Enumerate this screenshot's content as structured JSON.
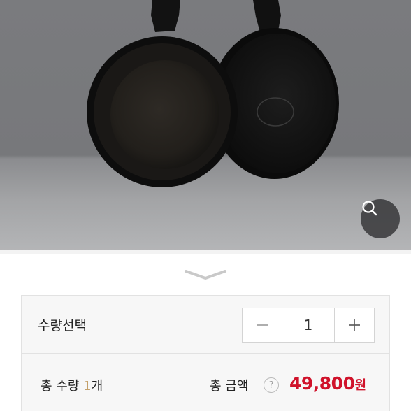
{
  "product_image": {
    "description_icon": "frying-pan-pair-image"
  },
  "zoom": {
    "icon": "search-icon"
  },
  "sheet": {
    "handle_icon": "chevron-down-icon"
  },
  "quantity": {
    "label": "수량선택",
    "value": "1",
    "minus_icon": "minus-icon",
    "plus_icon": "plus-icon"
  },
  "totals": {
    "qty_label": "총 수량",
    "qty_value": "1",
    "qty_unit": "개",
    "amount_label": "총 금액",
    "help_symbol": "?",
    "price": "49,800",
    "currency": "원"
  },
  "colors": {
    "price": "#d0132b",
    "qty_accent": "#c4a06a"
  }
}
